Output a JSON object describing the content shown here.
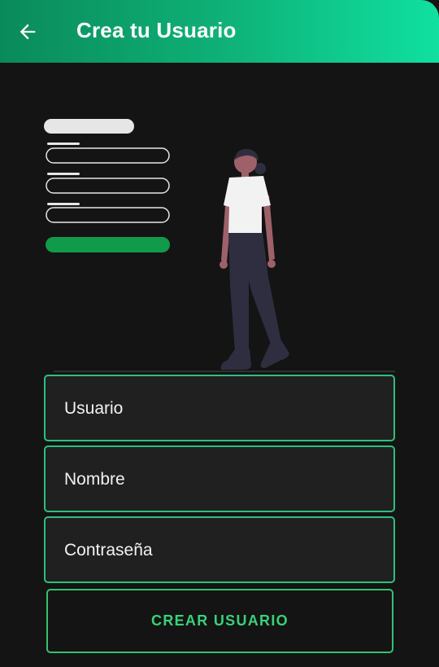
{
  "appbar": {
    "title": "Crea tu Usuario",
    "back_icon": "arrow-left-icon",
    "gradient_colors": [
      "#0a8a5a",
      "#10e0a0"
    ]
  },
  "form": {
    "username_placeholder": "Usuario",
    "name_placeholder": "Nombre",
    "password_placeholder": "Contraseña",
    "submit_label": "CREAR USUARIO"
  },
  "colors": {
    "background": "#141414",
    "field_background": "#202020",
    "field_border": "#2fbf80",
    "accent": "#3ad07a"
  }
}
